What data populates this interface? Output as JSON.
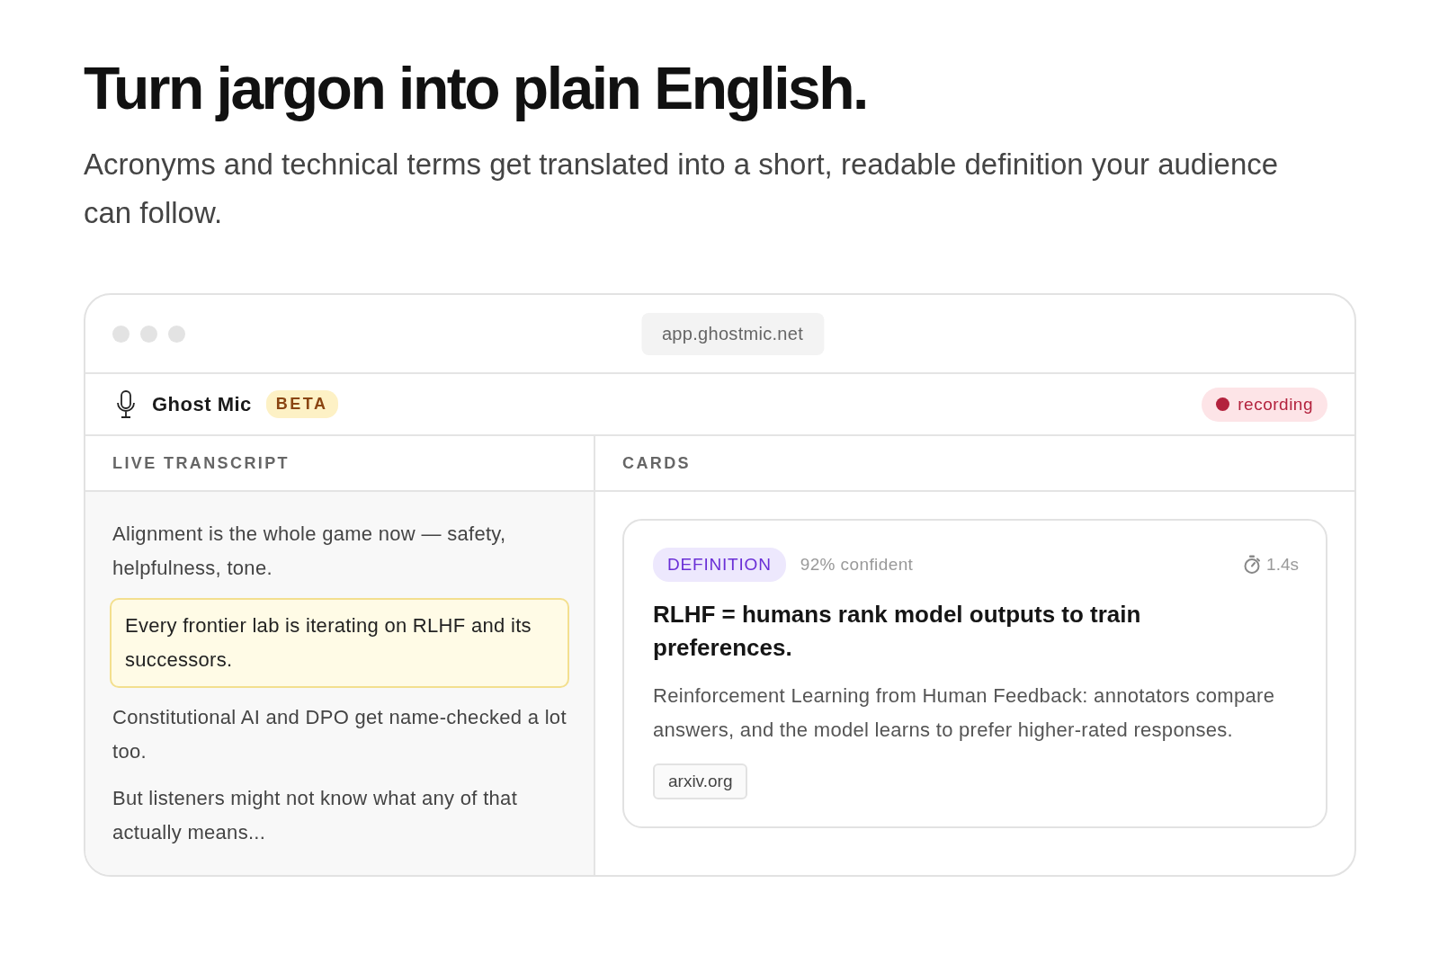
{
  "heading": "Turn jargon into plain English.",
  "subtitle": "Acronyms and technical terms get translated into a short, readable definition your audience can follow.",
  "window": {
    "url": "app.ghostmic.net",
    "app": {
      "name": "Ghost Mic",
      "badge": "BETA",
      "status": "recording",
      "recording": true
    },
    "transcript": {
      "title": "LIVE TRANSCRIPT",
      "lines": [
        {
          "text": "Alignment is the whole game now — safety, helpfulness, tone.",
          "highlighted": false
        },
        {
          "text": "Every frontier lab is iterating on RLHF and its successors.",
          "highlighted": true
        },
        {
          "text": "Constitutional AI and DPO get name-checked a lot too.",
          "highlighted": false
        },
        {
          "text": "But listeners might not know what any of that actually means...",
          "highlighted": false
        }
      ]
    },
    "cards": {
      "title": "CARDS",
      "items": [
        {
          "kind": "definition",
          "tag": "DEFINITION",
          "confidence": "92% confident",
          "latency": "1.4s",
          "title": "RLHF = humans rank model outputs to train preferences.",
          "body": "Reinforcement Learning from Human Feedback: annotators compare answers, and the model learns to prefer higher-rated responses.",
          "source": "arxiv.org"
        }
      ]
    }
  }
}
